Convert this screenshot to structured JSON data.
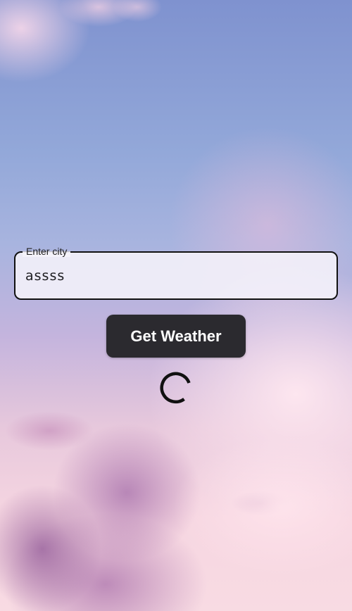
{
  "form": {
    "city_label": "Enter city",
    "city_value": "assss",
    "submit_label": "Get Weather"
  },
  "status": {
    "loading": true
  },
  "colors": {
    "button_bg": "#2b2a2f",
    "button_text": "#ffffff",
    "field_border": "#111111",
    "spinner": "#111111"
  }
}
